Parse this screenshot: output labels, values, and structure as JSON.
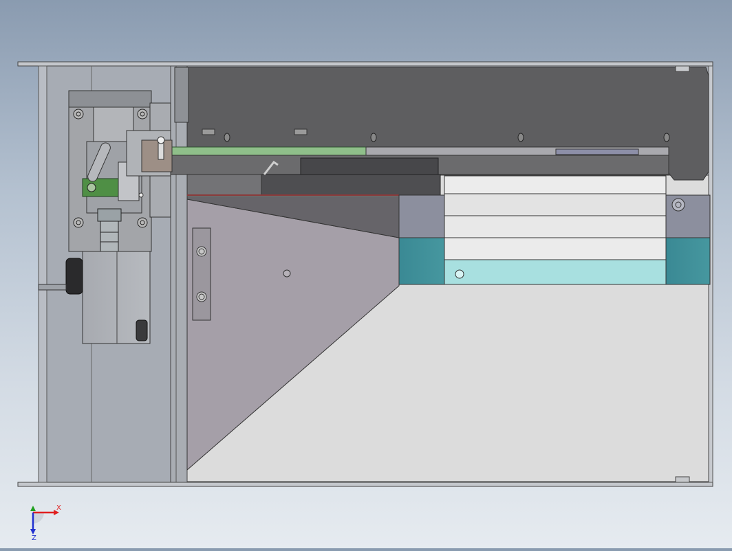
{
  "viewport": {
    "name": "cad-graphics-area",
    "background_top": "#8a9bb0",
    "background_bottom": "#e6ebf0"
  },
  "triad": {
    "x_label": "X",
    "z_label": "Z",
    "x_color": "#e02020",
    "z_color": "#2030d0",
    "origin_color": "#20a020"
  },
  "colors": {
    "frame": "#b9bdc4",
    "dark_plate": "#5e5e60",
    "sheet_grey": "#a59fa8",
    "light_panel": "#dcdcdc",
    "teal_block": "#3f8e99",
    "light_teal": "#a8e0e0",
    "slate_block": "#8c8f9e",
    "green_rail": "#8fbf8a",
    "green_bracket": "#4f8f45"
  }
}
